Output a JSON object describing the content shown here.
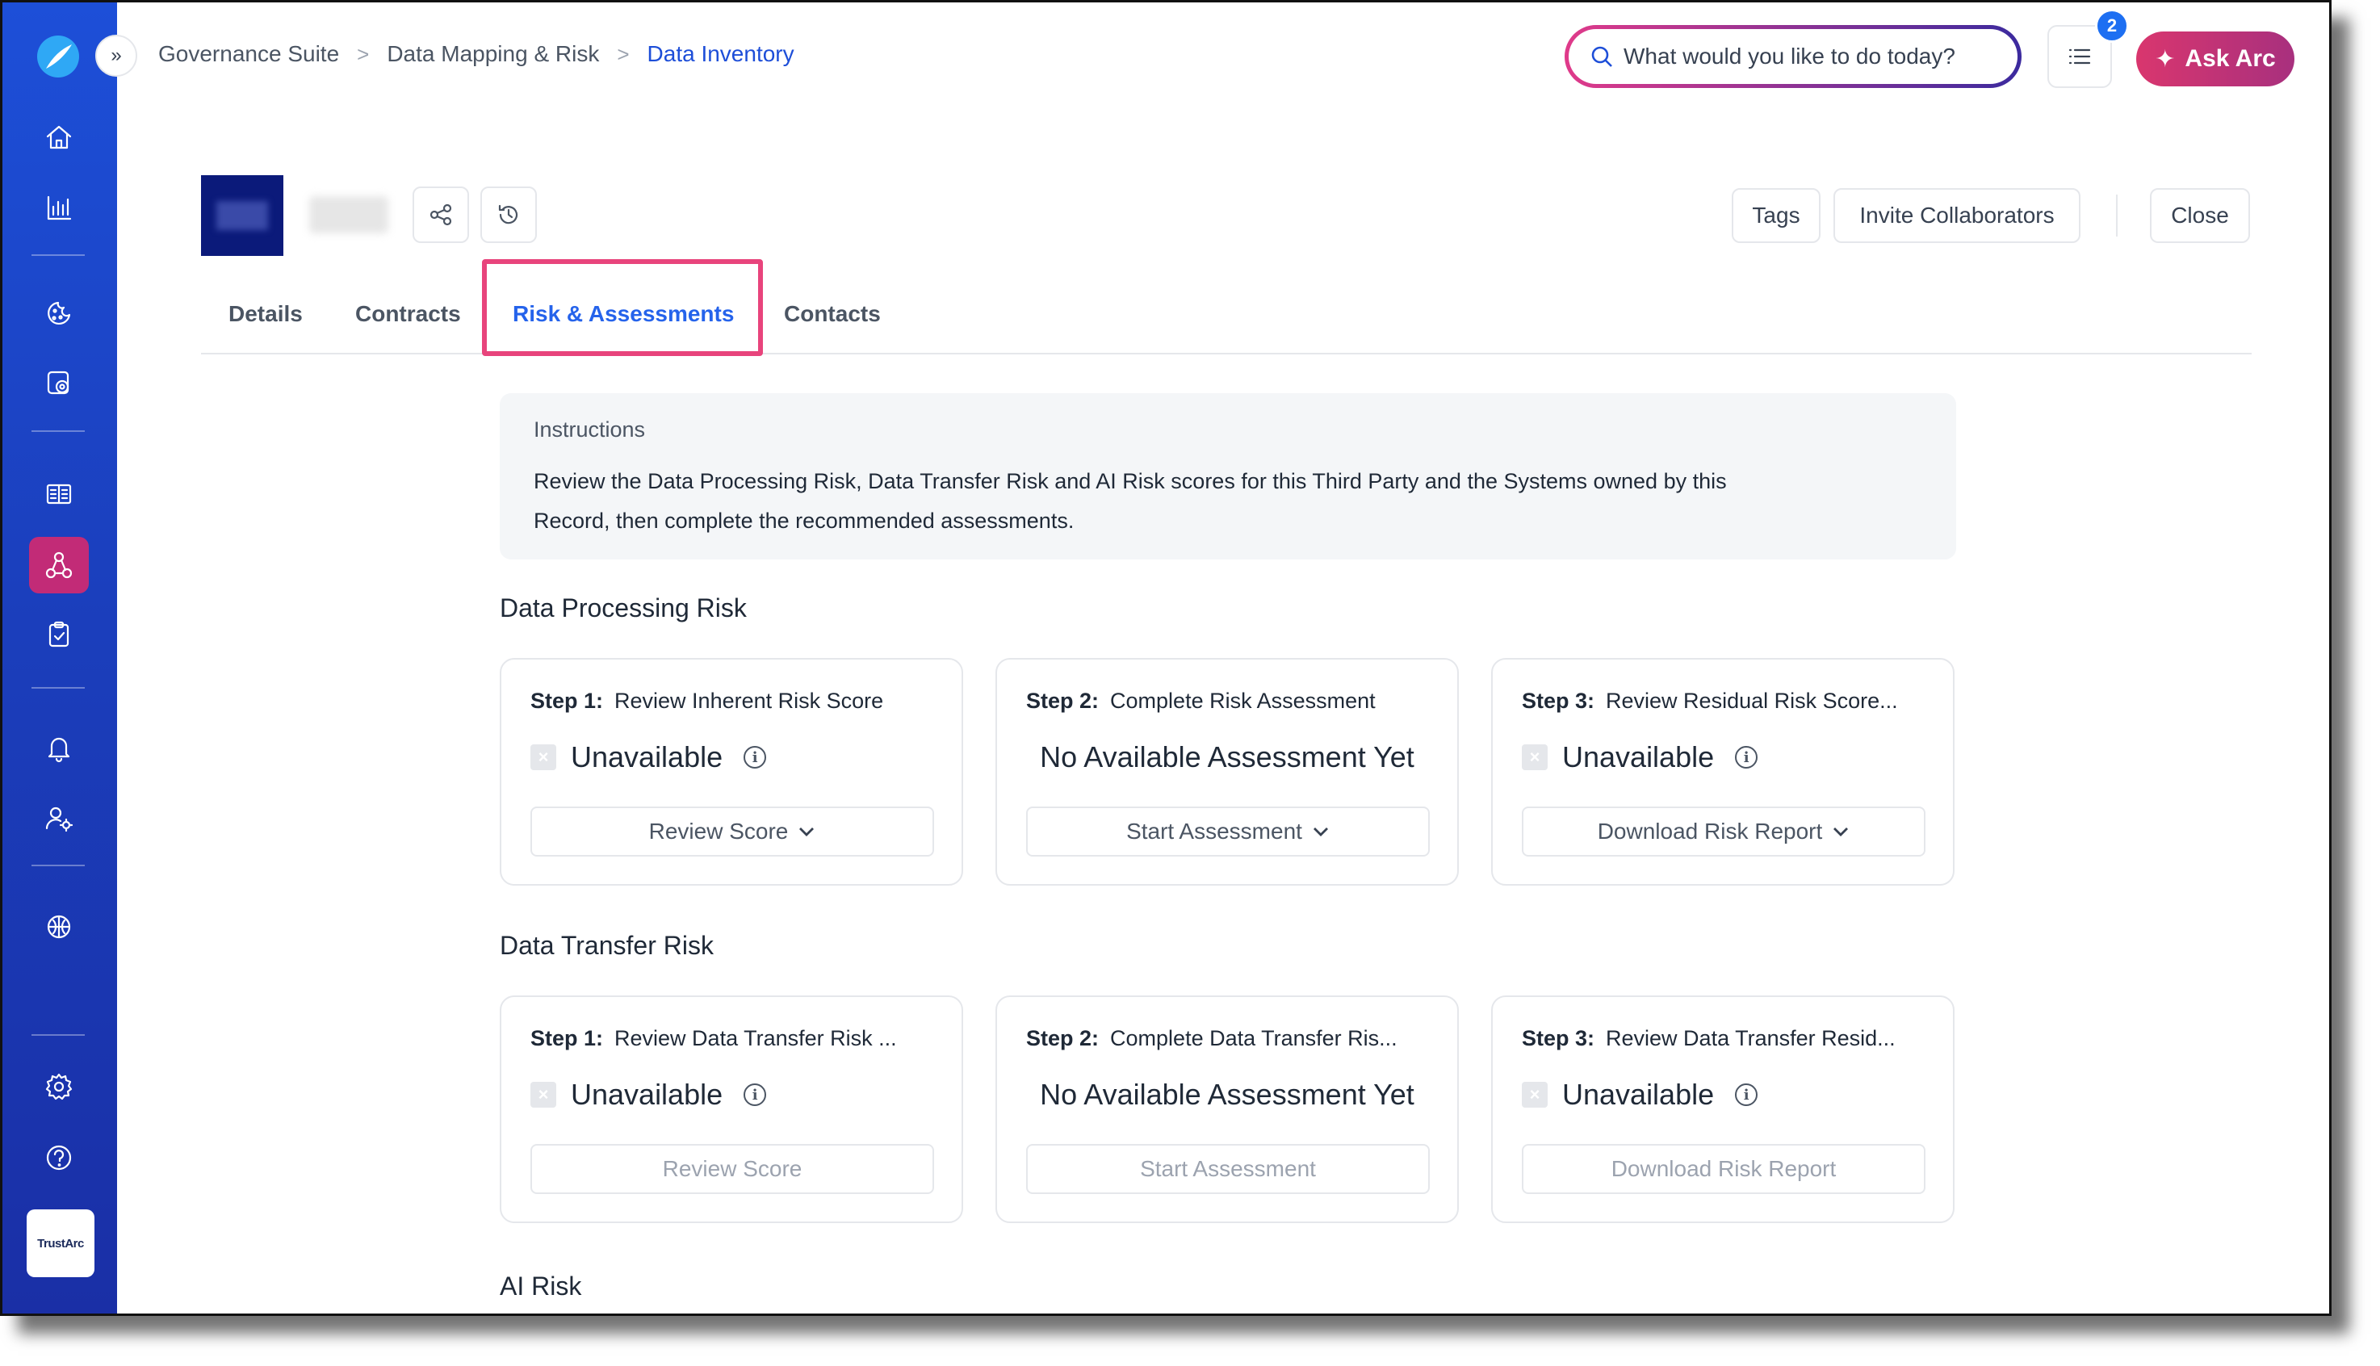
{
  "sidebar": {
    "brand_label": "TrustArc",
    "items": [
      {
        "icon": "home-icon"
      },
      {
        "icon": "analytics-icon"
      },
      {
        "icon": "cookie-consent-icon"
      },
      {
        "icon": "privacy-settings-icon"
      },
      {
        "icon": "catalog-icon"
      },
      {
        "icon": "data-mapping-icon",
        "active": true
      },
      {
        "icon": "assessments-icon"
      },
      {
        "icon": "notifications-icon"
      },
      {
        "icon": "user-settings-icon"
      },
      {
        "icon": "ai-brain-icon"
      },
      {
        "icon": "settings-icon"
      },
      {
        "icon": "help-icon"
      }
    ],
    "accent": "#c22b77"
  },
  "header": {
    "breadcrumb": [
      "Governance Suite",
      "Data Mapping & Risk",
      "Data Inventory"
    ],
    "search_placeholder": "What would you like to do today?",
    "notification_count": "2",
    "ask_label": "Ask Arc"
  },
  "record": {
    "tags_label": "Tags",
    "invite_label": "Invite Collaborators",
    "close_label": "Close"
  },
  "tabs": [
    {
      "label": "Details"
    },
    {
      "label": "Contracts"
    },
    {
      "label": "Risk & Assessments",
      "active": true
    },
    {
      "label": "Contacts"
    }
  ],
  "instructions": {
    "title": "Instructions",
    "line1": "Review the Data Processing Risk, Data Transfer Risk and AI Risk scores for this Third Party and the Systems owned by this",
    "line2": "Record, then complete the recommended assessments."
  },
  "sections": [
    {
      "title": "Data Processing Risk",
      "cards": [
        {
          "step": "Step 1:",
          "label": "Review Inherent Risk Score",
          "status": "Unavailable",
          "action": "Review Score",
          "dropdown": true
        },
        {
          "step": "Step 2:",
          "label": "Complete Risk Assessment",
          "status": "No Available Assessment Yet",
          "action": "Start Assessment",
          "dropdown": true
        },
        {
          "step": "Step 3:",
          "label": "Review Residual Risk Score...",
          "status": "Unavailable",
          "action": "Download Risk Report",
          "dropdown": true
        }
      ]
    },
    {
      "title": "Data Transfer Risk",
      "cards": [
        {
          "step": "Step 1:",
          "label": "Review Data Transfer Risk ...",
          "status": "Unavailable",
          "action": "Review Score",
          "dropdown": false
        },
        {
          "step": "Step 2:",
          "label": "Complete Data Transfer Ris...",
          "status": "No Available Assessment Yet",
          "action": "Start Assessment",
          "dropdown": false
        },
        {
          "step": "Step 3:",
          "label": "Review Data Transfer Resid...",
          "status": "Unavailable",
          "action": "Download Risk Report",
          "dropdown": false
        }
      ]
    },
    {
      "title": "AI Risk"
    }
  ]
}
